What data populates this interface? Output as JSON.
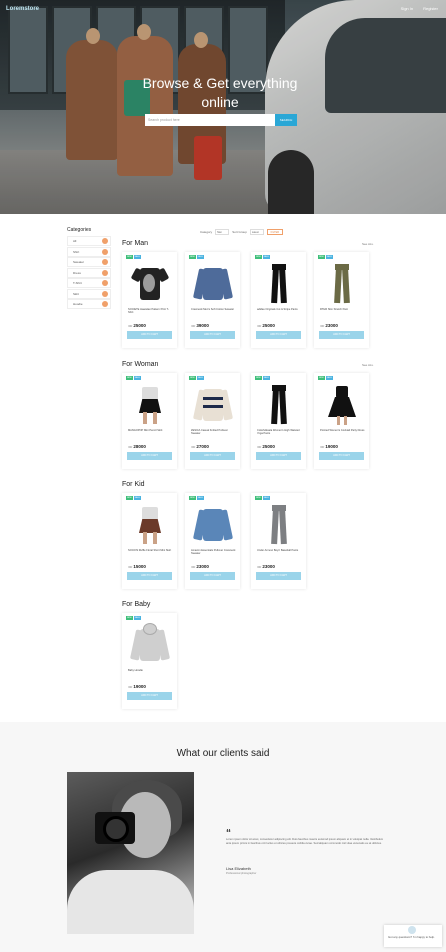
{
  "header": {
    "logo": "Loremstore",
    "nav": [
      "Sign In",
      "Register"
    ]
  },
  "hero": {
    "title": "Browse & Get everything online",
    "search_placeholder": "Search product here",
    "search_button": "SEARCH"
  },
  "sidebar": {
    "title": "Categories",
    "items": [
      {
        "label": "All",
        "count": ""
      },
      {
        "label": "Shirt",
        "count": ""
      },
      {
        "label": "Sweater",
        "count": ""
      },
      {
        "label": "Dress",
        "count": ""
      },
      {
        "label": "T-Shirt",
        "count": ""
      },
      {
        "label": "Skirt",
        "count": ""
      },
      {
        "label": "Hoodie",
        "count": ""
      }
    ]
  },
  "filter": {
    "category_label": "Category",
    "category_value": "Men",
    "sort_label": "Sort Group",
    "sort_value": "Latest",
    "button": "FILTER"
  },
  "sections": [
    {
      "title": "For Man",
      "see_all": "See ALL",
      "products": [
        {
          "name": "SOCIETE Hawaiian Pattern Print T-Shirt",
          "price": "25000",
          "currency": "IDR",
          "badges": [
            "NEW",
            "SALE"
          ],
          "button": "ADD TO CART"
        },
        {
          "name": "Crewneck Men's Soft Cotton Sweater",
          "price": "39000",
          "currency": "IDR",
          "badges": [
            "NEW",
            "SALE"
          ],
          "button": "ADD TO CART"
        },
        {
          "name": "adidas Originals Cut & Stripe Pants",
          "price": "25000",
          "currency": "IDR",
          "badges": [
            "NEW",
            "SALE"
          ],
          "button": "ADD TO CART"
        },
        {
          "name": "RTHR Slim Stretch Pant",
          "price": "23000",
          "currency": "IDR",
          "badges": [
            "NEW",
            "SALE"
          ],
          "button": "ADD TO CART"
        }
      ]
    },
    {
      "title": "For Woman",
      "see_all": "See ALL",
      "products": [
        {
          "name": "MANGOPOP Mini Pencil Skirt",
          "price": "28000",
          "currency": "IDR",
          "badges": [
            "NEW",
            "SALE"
          ],
          "button": "ADD TO CART"
        },
        {
          "name": "ZESICA Casual Knitted Pullover Sweater",
          "price": "27000",
          "currency": "IDR",
          "badges": [
            "NEW",
            "SALE"
          ],
          "button": "ADD TO CART"
        },
        {
          "name": "Colorfulkoala Women's High Waisted Yoga Pants",
          "price": "25000",
          "currency": "IDR",
          "badges": [
            "NEW",
            "SALE"
          ],
          "button": "ADD TO CART"
        },
        {
          "name": "Pointed Women's Cocktail Party Dress",
          "price": "19000",
          "currency": "IDR",
          "badges": [
            "NEW",
            "SALE"
          ],
          "button": "ADD TO CART"
        }
      ]
    },
    {
      "title": "For Kid",
      "see_all": "",
      "products": [
        {
          "name": "SOCIOS Ruffle Floral Short Mini Skirt",
          "price": "15000",
          "currency": "IDR",
          "badges": [
            "NEW",
            "SALE"
          ],
          "button": "ADD TO CART"
        },
        {
          "name": "Amazon Essentials Pullover Crewneck Sweater",
          "price": "23000",
          "currency": "IDR",
          "badges": [
            "NEW",
            "SALE"
          ],
          "button": "ADD TO CART"
        },
        {
          "name": "Under Armour Boys' Baseball Pants",
          "price": "23000",
          "currency": "IDR",
          "badges": [
            "NEW",
            "SALE"
          ],
          "button": "ADD TO CART"
        }
      ]
    },
    {
      "title": "For Baby",
      "see_all": "",
      "products": [
        {
          "name": "Baby Hoodie",
          "price": "19000",
          "currency": "IDR",
          "badges": [
            "NEW",
            "SALE"
          ],
          "button": "ADD TO CART"
        }
      ]
    }
  ],
  "testimonial": {
    "title": "What our clients said",
    "quote_mark": "“",
    "text": "Lorem ipsum dolor sit amet, consectetur adipiscing elit. Duis faucibus mauris euismod ipsum aliquam et in volutpat nulla. Vestibulum ante ipsum primis in faucibus orci luctus et ultrices posuere cubilia curae. Sed aliquam commodo nisl vitae venenatis eu at ultricies.",
    "name": "Lisa Elizabeth",
    "role": "Professional photographer"
  },
  "chat": {
    "text": "Got any questions? I'm happy to help."
  },
  "colors": {
    "accent": "#2aa7d6",
    "button": "#9ad4ea",
    "badge_new": "#3fbf7a",
    "badge_sale": "#4bb3e0",
    "count": "#f0a06a"
  }
}
